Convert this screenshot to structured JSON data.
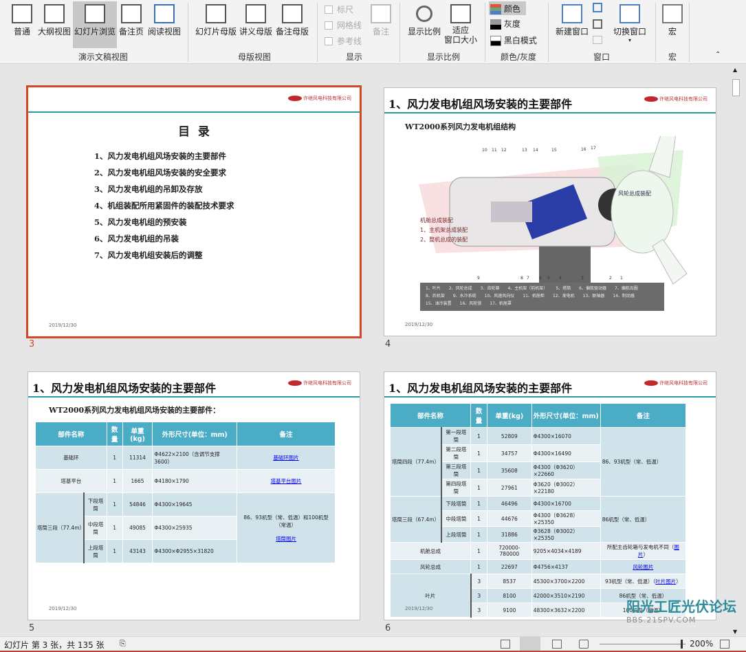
{
  "ribbon": {
    "groups": {
      "presentation_views": {
        "label": "演示文稿视图",
        "buttons": [
          "普通",
          "大纲视图",
          "幻灯片浏览",
          "备注页",
          "阅读视图"
        ],
        "selected": "幻灯片浏览"
      },
      "master_views": {
        "label": "母版视图",
        "buttons": [
          "幻灯片母版",
          "讲义母版",
          "备注母版"
        ]
      },
      "show": {
        "label": "显示",
        "checkboxes": [
          "标尺",
          "网格线",
          "参考线"
        ],
        "notes": "备注"
      },
      "zoom": {
        "label": "显示比例",
        "zoom": "显示比例",
        "fit_line1": "适应",
        "fit_line2": "窗口大小"
      },
      "color": {
        "label": "颜色/灰度",
        "items": [
          "颜色",
          "灰度",
          "黑白模式"
        ],
        "selected": "颜色"
      },
      "window": {
        "label": "窗口",
        "new_window": "新建窗口",
        "switch_window": "切换窗口"
      },
      "macro": {
        "label": "宏",
        "macros": "宏"
      }
    }
  },
  "slides": [
    {
      "number": "3",
      "selected": true,
      "logo": "许继风电科技有限公司",
      "heading": "目  录",
      "toc": [
        "1、风力发电机组风场安装的主要部件",
        "2、风力发电机组风场安装的安全要求",
        "3、风力发电机组的吊卸及存放",
        "4、机组装配所用紧固件的装配技术要求",
        "5、风力发电机组的预安装",
        "6、风力发电机组的吊装",
        "7、风力发电机组安装后的调整"
      ],
      "date": "2019/12/30"
    },
    {
      "number": "4",
      "title": "1、风力发电机组风场安装的主要部件",
      "logo": "许继风电科技有限公司",
      "subtitle": "WT2000系列风力发电机组结构",
      "diagram": {
        "nacelle_label": "机舱总成装配",
        "nacelle_steps": [
          "1、主机架总成装配",
          "2、整机总成的装配"
        ],
        "rotor_label": "风轮总成装配",
        "callouts": [
          "1",
          "2",
          "3",
          "4",
          "5",
          "6",
          "7",
          "8",
          "9",
          "10",
          "11",
          "12",
          "13",
          "14",
          "15",
          "16",
          "17"
        ],
        "legend": [
          "1、叶片",
          "2、风轮总成",
          "3、齿轮箱",
          "4、主机架（前机架）",
          "5、塔筒",
          "6、偏航驱动器",
          "7、偏航齿圈",
          "8、后机架",
          "9、水冷系统",
          "10、风速风向仪",
          "11、机舱柜",
          "12、发电机",
          "13、联轴器",
          "14、制动器",
          "15、油冷装置",
          "16、风轮锁",
          "17、机舱罩"
        ]
      },
      "date": "2019/12/30"
    },
    {
      "number": "5",
      "title": "1、风力发电机组风场安装的主要部件",
      "logo": "许继风电科技有限公司",
      "subtitle": "WT2000系列风力发电机组风场安装的主要部件：",
      "date": "2019/12/30",
      "table": {
        "headers": [
          "部件名称",
          "数量",
          "单重(kg)",
          "外形尺寸(单位：mm)",
          "备注"
        ],
        "rows": [
          [
            {
              "t": "基础环",
              "cs": 2
            },
            {
              "t": "1"
            },
            {
              "t": "11314"
            },
            {
              "t": "Φ4622×2100（含调节支撑3600）",
              "l": 1
            },
            {
              "t": "基础环图片",
              "link": 1
            }
          ],
          [
            {
              "t": "塔基平台",
              "cs": 2
            },
            {
              "t": "1"
            },
            {
              "t": "1665"
            },
            {
              "t": "Φ4180×1790",
              "l": 1
            },
            {
              "t": "塔基平台图片",
              "link": 1
            }
          ],
          [
            {
              "t": "塔筒三段（77.4m）",
              "rs": 3
            },
            {
              "t": "下段塔筒"
            },
            {
              "t": "1"
            },
            {
              "t": "54846"
            },
            {
              "t": "Φ4300×19645",
              "l": 1
            },
            {
              "t": "86、93机型（常、低温）和100机型（常温）",
              "rs": 3,
              "extra": "塔筒图片"
            }
          ],
          [
            {
              "t": "中段塔筒"
            },
            {
              "t": "1"
            },
            {
              "t": "49085"
            },
            {
              "t": "Φ4300×25935",
              "l": 1
            }
          ],
          [
            {
              "t": "上段塔筒"
            },
            {
              "t": "1"
            },
            {
              "t": "43143"
            },
            {
              "t": "Φ4300×Φ2955×31820",
              "l": 1
            }
          ]
        ]
      }
    },
    {
      "number": "6",
      "title": "1、风力发电机组风场安装的主要部件",
      "logo": "许继风电科技有限公司",
      "date": "2019/12/30",
      "table": {
        "headers": [
          "部件名称",
          "数量",
          "单重(kg)",
          "外形尺寸(单位：mm)",
          "备注"
        ],
        "rows": [
          [
            {
              "t": "塔筒四段（77.4m）",
              "rs": 4
            },
            {
              "t": "第一段塔筒"
            },
            {
              "t": "1"
            },
            {
              "t": "52809"
            },
            {
              "t": "Φ4300×16070",
              "l": 1
            },
            {
              "t": "86、93机型（常、低温）",
              "rs": 4,
              "l": 1
            }
          ],
          [
            {
              "t": "第二段塔筒"
            },
            {
              "t": "1"
            },
            {
              "t": "34757"
            },
            {
              "t": "Φ4300×16490",
              "l": 1
            }
          ],
          [
            {
              "t": "第三段塔筒"
            },
            {
              "t": "1"
            },
            {
              "t": "35608"
            },
            {
              "t": "Φ4300（Φ3620）×22660",
              "l": 1
            }
          ],
          [
            {
              "t": "第四段塔筒"
            },
            {
              "t": "1"
            },
            {
              "t": "27961"
            },
            {
              "t": "Φ3620（Φ3002）×22180",
              "l": 1
            }
          ],
          [
            {
              "t": "塔筒三段（67.4m）",
              "rs": 3
            },
            {
              "t": "下段塔筒"
            },
            {
              "t": "1"
            },
            {
              "t": "46496"
            },
            {
              "t": "Φ4300×16700",
              "l": 1
            },
            {
              "t": "86机型（常、低温）",
              "rs": 3,
              "l": 1
            }
          ],
          [
            {
              "t": "中段塔筒"
            },
            {
              "t": "1"
            },
            {
              "t": "44676"
            },
            {
              "t": "Φ4300（Φ3628）×25350",
              "l": 1
            }
          ],
          [
            {
              "t": "上段塔筒"
            },
            {
              "t": "1"
            },
            {
              "t": "31886"
            },
            {
              "t": "Φ3628（Φ3002）×25350",
              "l": 1
            }
          ],
          [
            {
              "t": "机舱总成",
              "cs": 2
            },
            {
              "t": "1"
            },
            {
              "t": "720000-780000"
            },
            {
              "t": "9205×4034×4189",
              "l": 1
            },
            {
              "t": "所配主齿轮箱与发电机不同（",
              "link_after": "图片",
              "close": "）"
            }
          ],
          [
            {
              "t": "风轮总成",
              "cs": 2
            },
            {
              "t": "1"
            },
            {
              "t": "22697"
            },
            {
              "t": "Φ4756×4137",
              "l": 1
            },
            {
              "t": "风轮图片",
              "link": 1
            }
          ],
          [
            {
              "t": "叶片",
              "cs": 2,
              "rs": 3
            },
            {
              "t": "3"
            },
            {
              "t": "8537"
            },
            {
              "t": "45300×3700×2200",
              "l": 1
            },
            {
              "t": "93机型（常、低温）（",
              "link_after": "叶片图片",
              "close": "）"
            }
          ],
          [
            {
              "t": "3"
            },
            {
              "t": "8100"
            },
            {
              "t": "42000×3510×2190",
              "l": 1
            },
            {
              "t": "86机型（常、低温）"
            }
          ],
          [
            {
              "t": "3"
            },
            {
              "t": "9100"
            },
            {
              "t": "48300×3632×2200",
              "l": 1
            },
            {
              "t": "100机型（常温）"
            }
          ]
        ]
      }
    }
  ],
  "status": {
    "slide_info": "幻灯片 第 3 张，共 135 张",
    "zoom": "200%"
  },
  "watermark": {
    "text": "阳光工匠光伏论坛",
    "url_text": "BBS.21SPV.COM"
  },
  "colors": {
    "accent": "#d24726",
    "table_header": "#4bacc6",
    "title_line": "#2a9aa0"
  }
}
